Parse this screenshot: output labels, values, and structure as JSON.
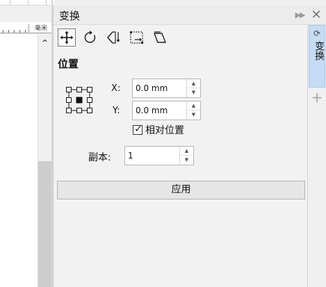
{
  "ruler": {
    "units": "毫米"
  },
  "docker": {
    "title": "变换",
    "collapse_glyph": "▶▶",
    "close_glyph": "✕"
  },
  "toolbar": {
    "tools": [
      {
        "name": "position",
        "icon": "position-move-icon",
        "active": true
      },
      {
        "name": "rotate",
        "icon": "rotate-icon",
        "active": false
      },
      {
        "name": "scale-mirror",
        "icon": "scale-mirror-icon",
        "active": false
      },
      {
        "name": "size",
        "icon": "size-icon",
        "active": false
      },
      {
        "name": "skew",
        "icon": "skew-icon",
        "active": false
      }
    ]
  },
  "position_section": {
    "title": "位置",
    "x_label": "X:",
    "x_value": "0.0 mm",
    "y_label": "Y:",
    "y_value": "0.0 mm",
    "relative_checkbox_label": "相对位置",
    "relative_checked": true,
    "copies_label": "副本:",
    "copies_value": "1",
    "anchor_selected": "center"
  },
  "apply_label": "应用",
  "side_tabs": {
    "active_tab_label": "变换",
    "add_glyph": "+"
  },
  "colors": {
    "active_tab_bg": "#c5dcf4",
    "panel_bg": "#f2f2f2",
    "canvas_bg": "#ffffff"
  }
}
